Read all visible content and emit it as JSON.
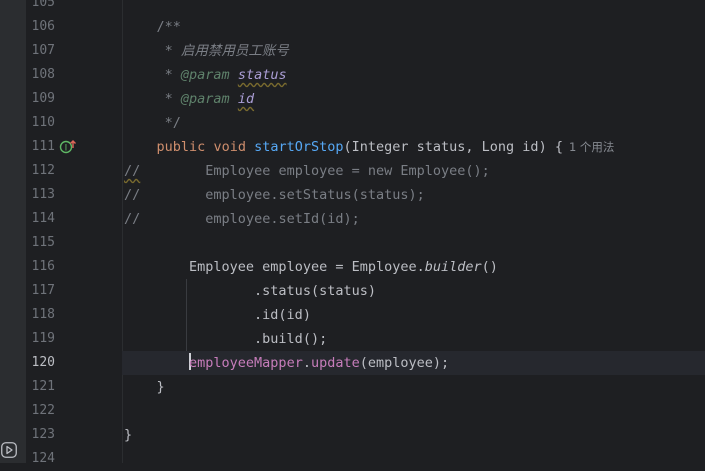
{
  "editor": {
    "current_line": 120,
    "lines": [
      {
        "n": "105"
      },
      {
        "n": "106",
        "comment": "/**"
      },
      {
        "n": "107",
        "star": "* ",
        "text": "启用禁用员工账号"
      },
      {
        "n": "108",
        "star": "* ",
        "tag": "@param",
        "param": "status"
      },
      {
        "n": "109",
        "star": "* ",
        "tag": "@param",
        "param": "id"
      },
      {
        "n": "110",
        "comment": "*/"
      },
      {
        "n": "111",
        "kw1": "public",
        "kw2": "void",
        "method": "startOrStop",
        "sig": "(Integer status, Long id) {",
        "usage_hint": "1 个用法"
      },
      {
        "n": "112",
        "prefix": "//",
        "code": "Employee employee = new Employee();"
      },
      {
        "n": "113",
        "prefix": "//",
        "code": "employee.setStatus(status);"
      },
      {
        "n": "114",
        "prefix": "//",
        "code": "employee.setId(id);"
      },
      {
        "n": "115"
      },
      {
        "n": "116",
        "part1": "Employee employee = Employee.",
        "static_call": "builder",
        "part2": "()"
      },
      {
        "n": "117",
        "code": ".status(status)"
      },
      {
        "n": "118",
        "code": ".id(id)"
      },
      {
        "n": "119",
        "code": ".build();"
      },
      {
        "n": "120",
        "field": "employeeMapper",
        "dot": ".",
        "call": "update",
        "args": "(employee);"
      },
      {
        "n": "121",
        "code": "}"
      },
      {
        "n": "122"
      },
      {
        "n": "123",
        "code": "}"
      },
      {
        "n": "124"
      }
    ]
  },
  "gutter": {
    "line111_icon": "implementation-override-icon",
    "bottom_icon": "run-icon"
  },
  "colors": {
    "background": "#1e1f22",
    "keyword": "#cf8e6d",
    "method_declaration": "#56a8f5",
    "comment": "#7a7e85",
    "field": "#c77dbb",
    "text": "#bcbec4"
  }
}
